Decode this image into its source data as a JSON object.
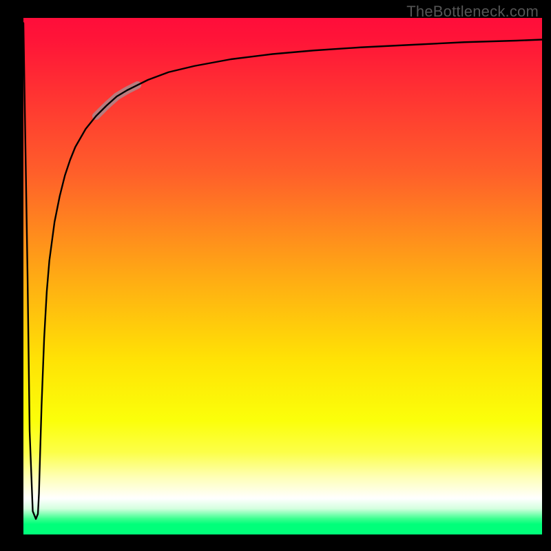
{
  "attribution": "TheBottleneck.com",
  "chart_data": {
    "type": "line",
    "title": "",
    "xlabel": "",
    "ylabel": "",
    "xlim": [
      0,
      100
    ],
    "ylim": [
      0,
      100
    ],
    "x": [
      0,
      0.8,
      1.2,
      1.8,
      2.4,
      2.8,
      3.0,
      3.2,
      3.5,
      4.0,
      4.5,
      5.0,
      6.0,
      7.0,
      8.0,
      9.0,
      10.0,
      12.0,
      14.0,
      16.0,
      18.0,
      20.0,
      24.0,
      28.0,
      33.0,
      40.0,
      48.0,
      56.0,
      65.0,
      75.0,
      85.0,
      95.0,
      100.0
    ],
    "values": [
      99.0,
      50.0,
      20.0,
      4.5,
      3.0,
      4.0,
      8.0,
      15.0,
      25.0,
      38.0,
      47.0,
      53.0,
      60.5,
      65.5,
      69.5,
      72.5,
      75.0,
      78.5,
      81.0,
      83.0,
      84.8,
      86.0,
      88.0,
      89.5,
      90.7,
      92.0,
      93.0,
      93.7,
      94.3,
      94.8,
      95.3,
      95.6,
      95.8
    ],
    "highlight_segment": {
      "x_start": 14.0,
      "x_end": 22.0
    },
    "background_gradient": {
      "direction": "top-to-bottom",
      "stops": [
        {
          "offset": 0.0,
          "color": "#ff0d3a"
        },
        {
          "offset": 0.3,
          "color": "#ff5f2a"
        },
        {
          "offset": 0.5,
          "color": "#ffaa14"
        },
        {
          "offset": 0.66,
          "color": "#ffe205"
        },
        {
          "offset": 0.84,
          "color": "#fcff47"
        },
        {
          "offset": 0.93,
          "color": "#ffffff"
        },
        {
          "offset": 0.98,
          "color": "#00ff7a"
        }
      ]
    }
  }
}
